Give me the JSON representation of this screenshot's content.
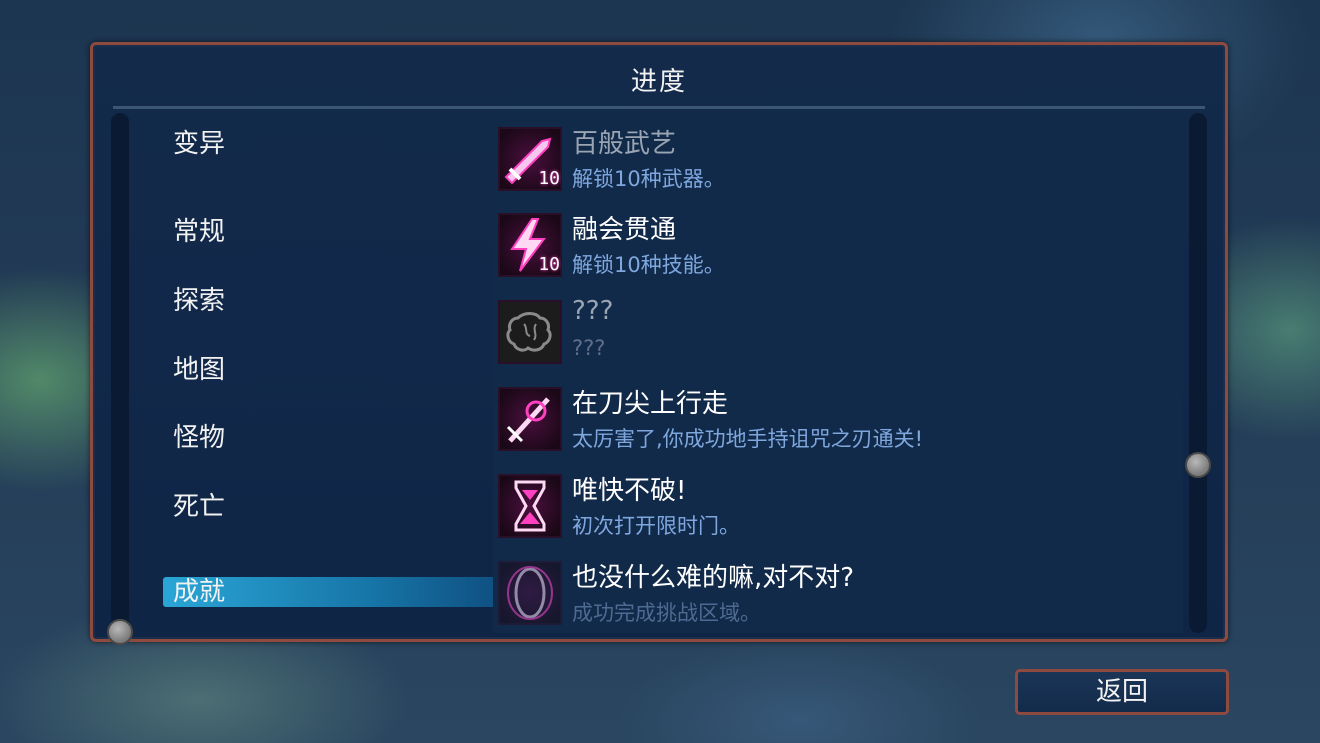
{
  "panel": {
    "title": "进度"
  },
  "categories": [
    {
      "label": "变异"
    },
    {
      "label": "常规"
    },
    {
      "label": "探索"
    },
    {
      "label": "地图"
    },
    {
      "label": "怪物"
    },
    {
      "label": "死亡"
    },
    {
      "label": "成就",
      "selected": true
    }
  ],
  "achievements": [
    {
      "title": "百般武艺",
      "desc": "解锁10种武器。",
      "badge": "10",
      "icon": "sword-icon",
      "locked": false,
      "title_dimmed": true
    },
    {
      "title": "融会贯通",
      "desc": "解锁10种技能。",
      "badge": "10",
      "icon": "lightning-icon",
      "locked": false
    },
    {
      "title": "???",
      "desc": "???",
      "icon": "brain-icon",
      "locked": true
    },
    {
      "title": "在刀尖上行走",
      "desc": "太厉害了,你成功地手持诅咒之刃通关!",
      "icon": "cursed-blade-icon",
      "locked": false
    },
    {
      "title": "唯快不破!",
      "desc": "初次打开限时门。",
      "icon": "hourglass-icon",
      "locked": false
    },
    {
      "title": "也没什么难的嘛,对不对?",
      "desc": "成功完成挑战区域。",
      "icon": "rings-icon",
      "locked": false,
      "partially_visible": true
    }
  ],
  "footer": {
    "back_label": "返回"
  },
  "colors": {
    "accent": "#2aa6d6",
    "frame": "#8e4a3e",
    "icon_glow": "#ff40c0"
  }
}
